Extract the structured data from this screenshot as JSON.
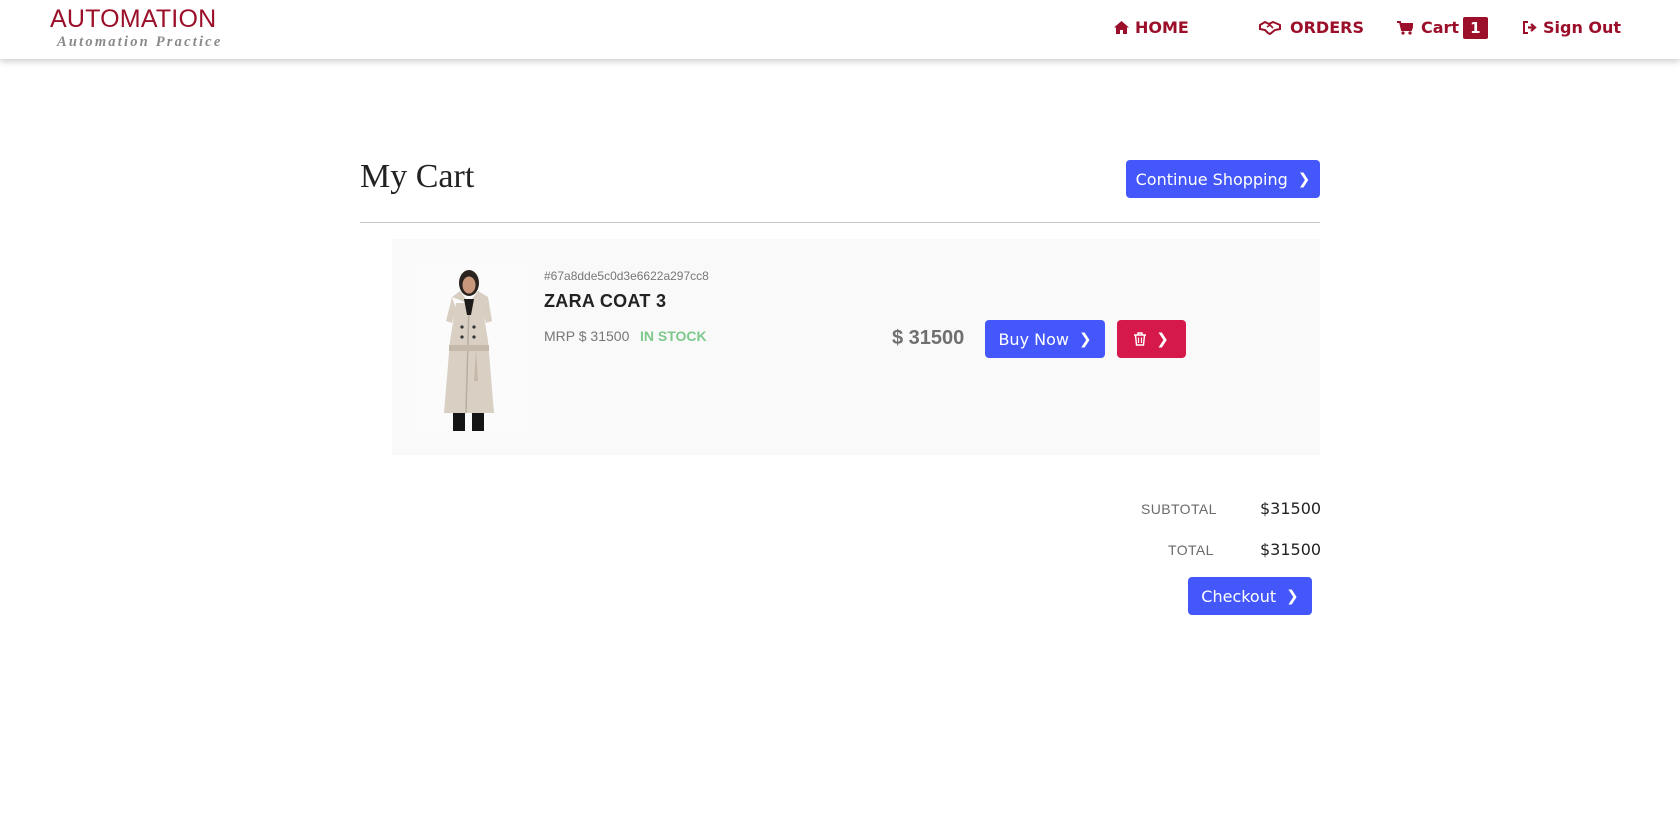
{
  "brand": {
    "title": "AUTOMATION",
    "subtitle": "Automation Practice",
    "color": "#9b0f2a"
  },
  "nav": {
    "home": {
      "label": "HOME",
      "icon": "home-icon"
    },
    "orders": {
      "label": "ORDERS",
      "icon": "handshake-icon"
    },
    "cart": {
      "label": "Cart",
      "icon": "cart-icon",
      "count": "1"
    },
    "signout": {
      "label": "Sign Out",
      "icon": "sign-out-icon"
    }
  },
  "page": {
    "title": "My Cart",
    "continue_label": "Continue Shopping",
    "accent": "#4357fb",
    "danger": "#d6194b"
  },
  "items": [
    {
      "id": "#67a8dde5c0d3e6622a297cc8",
      "name": "ZARA COAT 3",
      "mrp": "MRP $ 31500",
      "stock": "IN STOCK",
      "price": "$ 31500",
      "buy_label": "Buy Now",
      "delete_icon": "trash-icon"
    }
  ],
  "summary": {
    "subtotal_label": "SUBTOTAL",
    "subtotal_value": "$31500",
    "total_label": "TOTAL",
    "total_value": "$31500",
    "checkout_label": "Checkout"
  }
}
